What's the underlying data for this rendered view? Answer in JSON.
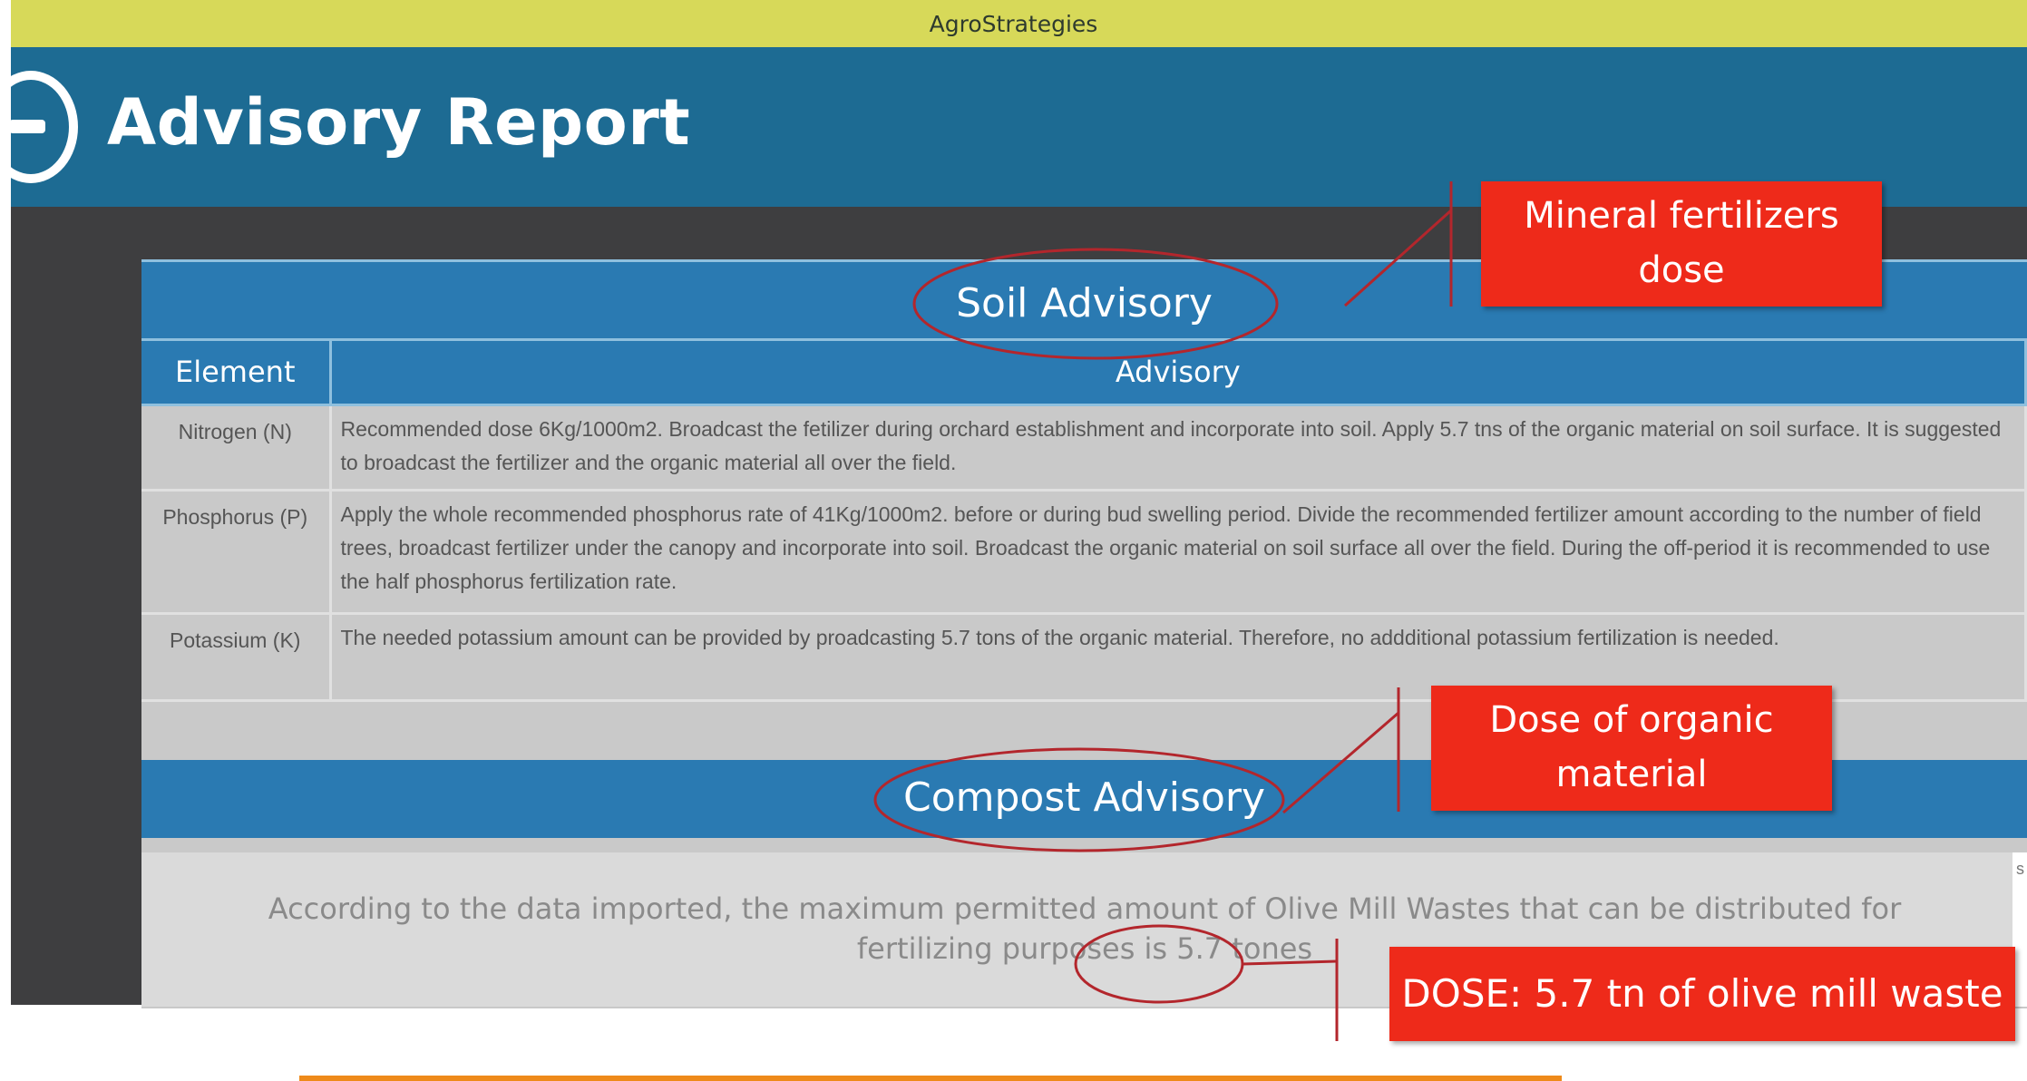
{
  "window": {
    "title": "AgroStrategies"
  },
  "header": {
    "title": "Advisory Report"
  },
  "soil": {
    "title": "Soil Advisory",
    "columns": [
      "Element",
      "Advisory"
    ],
    "rows": [
      {
        "element": "Nitrogen (N)",
        "advisory": "Recommended dose 6Kg/1000m2. Broadcast the fetilizer during orchard establishment and incorporate into soil. Apply 5.7 tns of the organic material on soil surface. It is suggested to broadcast the fertilizer and the organic material all over the field."
      },
      {
        "element": "Phosphorus (P)",
        "advisory": "Apply the whole recommended phosphorus rate of 41Kg/1000m2. before or during bud swelling period. Divide the recommended fertilizer amount according to the number of field trees, broadcast fertilizer under the canopy and incorporate into soil. Broadcast the organic material on soil surface all over the field. During the off-period it is recommended to use the half phosphorus fertilization rate."
      },
      {
        "element": "Potassium (K)",
        "advisory": "The needed potassium amount can be provided by proadcasting 5.7 tons of the organic material. Therefore, no addditional potassium fertilization is needed."
      }
    ]
  },
  "compost": {
    "title": "Compost Advisory",
    "text": "According to the data imported, the maximum permitted amount of Olive Mill Wastes that can be distributed for fertilizing purposes is 5.7 tones"
  },
  "annotations": {
    "mineral": "Mineral fertilizers dose",
    "organic": "Dose of organic material",
    "dose": "DOSE: 5.7 tn of olive mill waste"
  },
  "colors": {
    "titlebar": "#d7d959",
    "header": "#1d6b93",
    "section_header": "#2a7ab2",
    "callout": "#ee2a1a",
    "annotation_ink": "#b3262c"
  }
}
